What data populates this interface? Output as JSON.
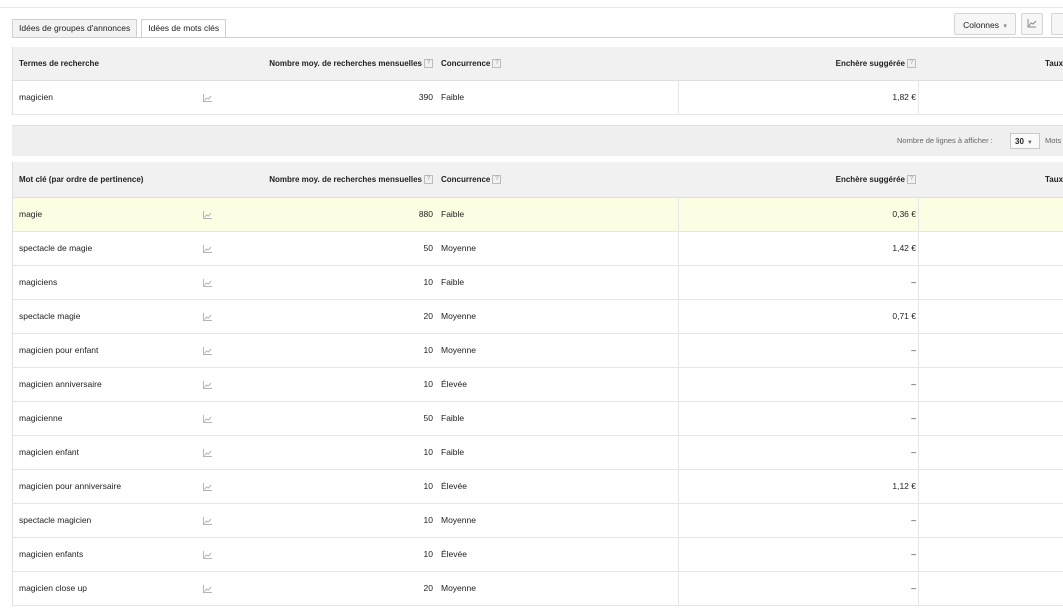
{
  "tabs": [
    {
      "label": "Idées de groupes d'annonces"
    },
    {
      "label": "Idées de mots clés"
    }
  ],
  "toolbar": {
    "columns_label": "Colonnes",
    "help_mark": "?"
  },
  "search_terms": {
    "headers": {
      "keyword": "Termes de recherche",
      "volume": "Nombre moy. de recherches mensuelles",
      "competition": "Concurrence",
      "bid": "Enchère suggérée",
      "rate": "Taux"
    },
    "rows": [
      {
        "keyword": "magicien",
        "volume": "390",
        "competition": "Faible",
        "bid": "1,82 €"
      }
    ]
  },
  "pager": {
    "label": "Nombre de lignes à afficher :",
    "rows_value": "30",
    "more_label": "Mots cl"
  },
  "ideas": {
    "headers": {
      "keyword": "Mot clé (par ordre de pertinence)",
      "volume": "Nombre moy. de recherches mensuelles",
      "competition": "Concurrence",
      "bid": "Enchère suggérée",
      "rate": "Taux"
    },
    "rows": [
      {
        "keyword": "magie",
        "volume": "880",
        "competition": "Faible",
        "bid": "0,36 €"
      },
      {
        "keyword": "spectacle de magie",
        "volume": "50",
        "competition": "Moyenne",
        "bid": "1,42 €"
      },
      {
        "keyword": "magiciens",
        "volume": "10",
        "competition": "Faible",
        "bid": "–"
      },
      {
        "keyword": "spectacle magie",
        "volume": "20",
        "competition": "Moyenne",
        "bid": "0,71 €"
      },
      {
        "keyword": "magicien pour enfant",
        "volume": "10",
        "competition": "Moyenne",
        "bid": "–"
      },
      {
        "keyword": "magicien anniversaire",
        "volume": "10",
        "competition": "Élevée",
        "bid": "–"
      },
      {
        "keyword": "magicienne",
        "volume": "50",
        "competition": "Faible",
        "bid": "–"
      },
      {
        "keyword": "magicien enfant",
        "volume": "10",
        "competition": "Faible",
        "bid": "–"
      },
      {
        "keyword": "magicien pour anniversaire",
        "volume": "10",
        "competition": "Élevée",
        "bid": "1,12 €"
      },
      {
        "keyword": "spectacle magicien",
        "volume": "10",
        "competition": "Moyenne",
        "bid": "–"
      },
      {
        "keyword": "magicien enfants",
        "volume": "10",
        "competition": "Élevée",
        "bid": "–"
      },
      {
        "keyword": "magicien close up",
        "volume": "20",
        "competition": "Moyenne",
        "bid": "–"
      }
    ]
  },
  "colors": {
    "highlight_row": "#fdfde4",
    "header_bg": "#f1f1f1",
    "border": "#e0e0e0"
  },
  "icons": {
    "trend": "trend-chart-icon",
    "columns_caret": "chevron-down-icon",
    "chart_toggle": "line-chart-icon"
  }
}
